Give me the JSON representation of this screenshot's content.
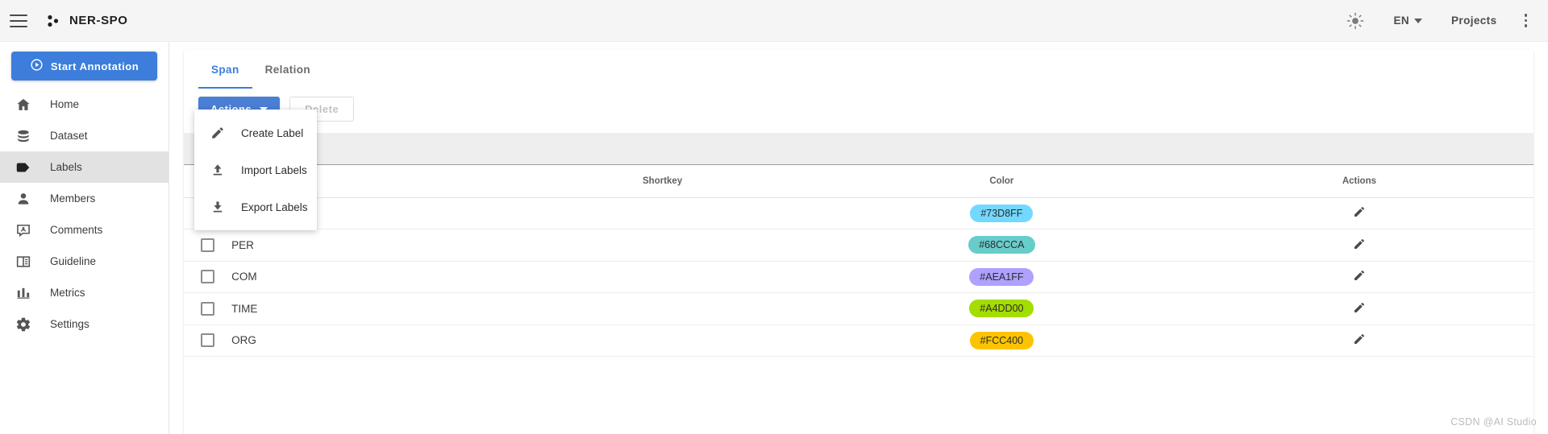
{
  "appbar": {
    "menu_icon": "hamburger-icon",
    "brand": "NER-SPO",
    "theme_icon": "sun-icon",
    "language": "EN",
    "projects": "Projects",
    "overflow_icon": "kebab-menu-icon"
  },
  "sidebar": {
    "start_button": "Start Annotation",
    "items": [
      {
        "label": "Home",
        "icon": "home-icon",
        "active": false
      },
      {
        "label": "Dataset",
        "icon": "database-icon",
        "active": false
      },
      {
        "label": "Labels",
        "icon": "tag-icon",
        "active": true
      },
      {
        "label": "Members",
        "icon": "person-icon",
        "active": false
      },
      {
        "label": "Comments",
        "icon": "comment-icon",
        "active": false
      },
      {
        "label": "Guideline",
        "icon": "book-icon",
        "active": false
      },
      {
        "label": "Metrics",
        "icon": "bar-chart-icon",
        "active": false
      },
      {
        "label": "Settings",
        "icon": "gear-icon",
        "active": false
      }
    ]
  },
  "main": {
    "tabs": [
      {
        "label": "Span",
        "active": true
      },
      {
        "label": "Relation",
        "active": false
      }
    ],
    "toolbar": {
      "actions_label": "Actions",
      "delete_label": "Delete"
    },
    "dropdown": {
      "open": true,
      "items": [
        {
          "label": "Create Label",
          "icon": "pencil-icon"
        },
        {
          "label": "Import Labels",
          "icon": "upload-icon"
        },
        {
          "label": "Export Labels",
          "icon": "download-icon"
        }
      ]
    },
    "table": {
      "headers": {
        "check": "",
        "name": "",
        "shortkey": "Shortkey",
        "color": "Color",
        "actions": "Actions"
      },
      "rows": [
        {
          "name": "",
          "shortkey": "",
          "color": "#73D8FF",
          "edit_icon": "pencil-icon"
        },
        {
          "name": "PER",
          "shortkey": "",
          "color": "#68CCCA",
          "edit_icon": "pencil-icon"
        },
        {
          "name": "COM",
          "shortkey": "",
          "color": "#AEA1FF",
          "edit_icon": "pencil-icon"
        },
        {
          "name": "TIME",
          "shortkey": "",
          "color": "#A4DD00",
          "edit_icon": "pencil-icon"
        },
        {
          "name": "ORG",
          "shortkey": "",
          "color": "#FCC400",
          "edit_icon": "pencil-icon"
        }
      ]
    }
  },
  "watermark": "CSDN @AI Studio",
  "colors": {
    "accent": "#3d7ddb",
    "appbar_bg": "#f5f5f5",
    "active_nav_bg": "#e2e2e2",
    "filter_bg": "#eeeeee"
  }
}
